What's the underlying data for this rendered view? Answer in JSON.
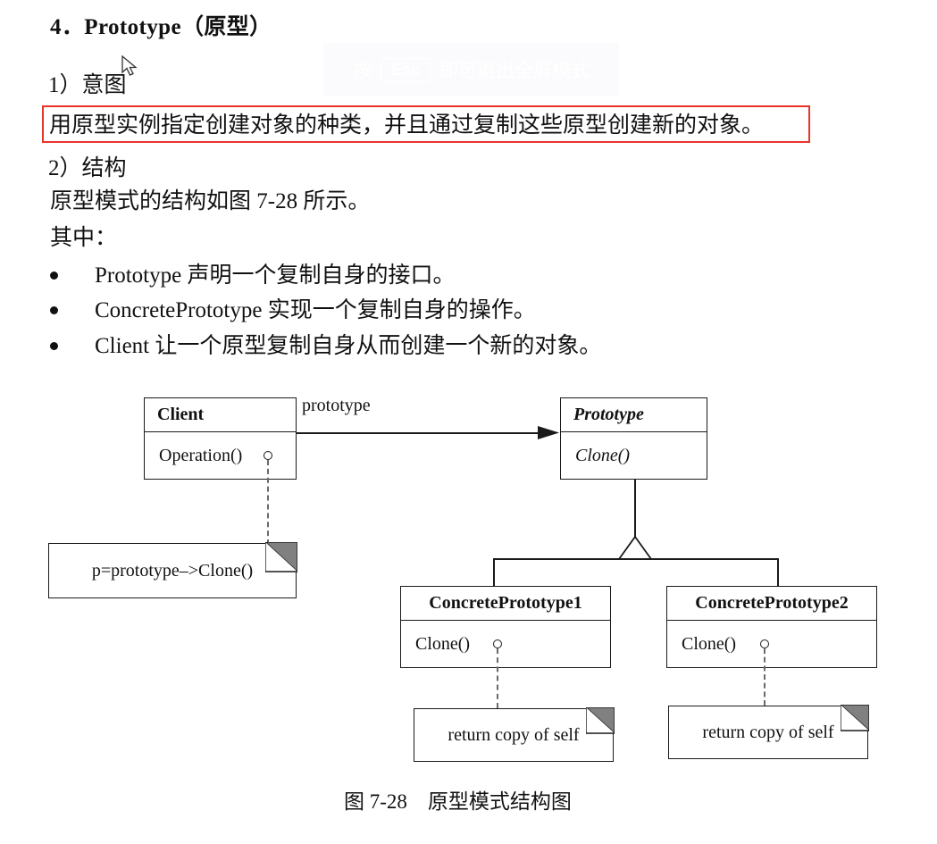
{
  "document": {
    "heading": "4．Prototype（原型）",
    "section_intent_label": "1）意图",
    "intent_text": "用原型实例指定创建对象的种类，并且通过复制这些原型创建新的对象。",
    "intent_box_color": "#e8342a",
    "section_structure_label": "2）结构",
    "structure_text": "原型模式的结构如图 7-28 所示。",
    "among_label": "其中：",
    "bullets": [
      "Prototype 声明一个复制自身的接口。",
      "ConcretePrototype 实现一个复制自身的操作。",
      "Client 让一个原型复制自身从而创建一个新的对象。"
    ],
    "figure_caption": "图 7-28    原型模式结构图"
  },
  "diagram": {
    "type": "uml-class-diagram",
    "classes": [
      {
        "id": "client",
        "name": "Client",
        "name_style": "bold",
        "members": [
          "Operation()"
        ],
        "member_style": "plain"
      },
      {
        "id": "prototype",
        "name": "Prototype",
        "name_style": "bold-italic",
        "members": [
          "Clone()"
        ],
        "member_style": "italic"
      },
      {
        "id": "concrete1",
        "name": "ConcretePrototype1",
        "name_style": "bold",
        "members": [
          "Clone()"
        ],
        "member_style": "plain"
      },
      {
        "id": "concrete2",
        "name": "ConcretePrototype2",
        "name_style": "bold",
        "members": [
          "Clone()"
        ],
        "member_style": "plain"
      }
    ],
    "association_label": "prototype",
    "notes": [
      {
        "id": "note-client",
        "text": "p=prototype–>Clone()"
      },
      {
        "id": "note-concrete1",
        "text": "return copy of self"
      },
      {
        "id": "note-concrete2",
        "text": "return copy of self"
      }
    ]
  },
  "overlay": {
    "toast_prefix": "按",
    "toast_key": "Esc",
    "toast_suffix": "即可退出全屏模式"
  }
}
